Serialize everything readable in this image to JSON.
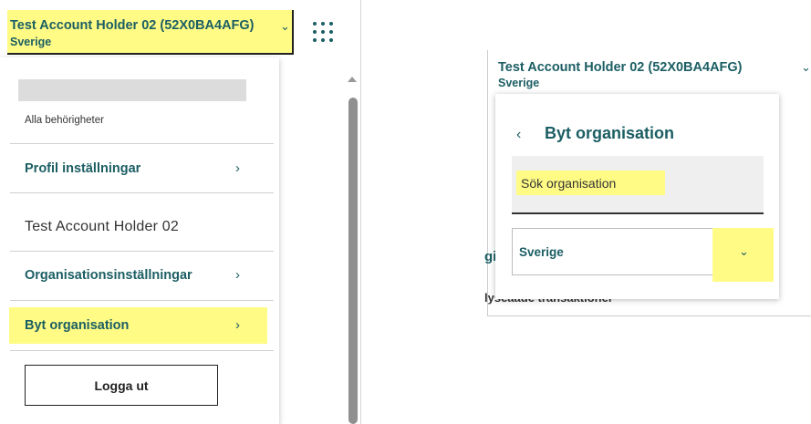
{
  "left": {
    "account": {
      "name": "Test Account Holder 02 (52X0BA4AFG)",
      "country": "Sverige",
      "chevron": "⌄"
    },
    "apps_icon": "grid-dots-icon",
    "permissions_text": "Alla behörigheter",
    "menu": {
      "profile_settings": "Profil inställningar",
      "holder_name": "Test Account Holder 02",
      "org_settings": "Organisationsinställningar",
      "switch_org": "Byt organisation",
      "chevron": "›"
    },
    "logout_label": "Logga ut"
  },
  "right": {
    "account": {
      "name": "Test Account Holder 02 (52X0BA4AFG)",
      "country": "Sverige",
      "chevron": "⌄"
    },
    "back_chevron": "‹",
    "title": "Byt organisation",
    "search": {
      "placeholder": "Sök organisation"
    },
    "country_select": {
      "value": "Sverige",
      "chevron": "⌄"
    },
    "bg_fragment_1": "gi",
    "bg_fragment_2": "lyseaade transaktioner"
  },
  "colors": {
    "brand_teal": "#1b5e63",
    "highlight_yellow": "#fffb85"
  }
}
